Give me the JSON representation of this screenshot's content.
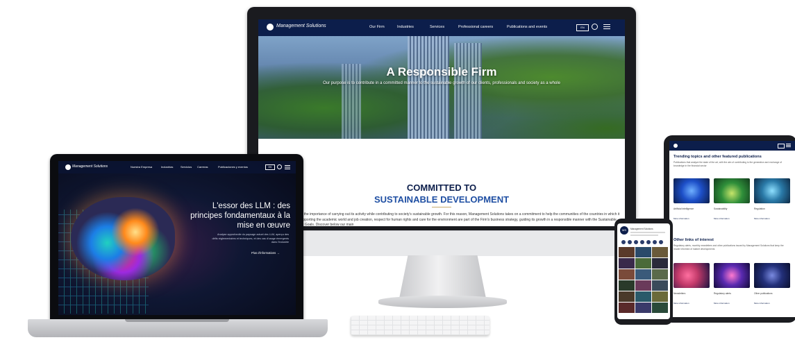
{
  "monitor": {
    "logo_text": "Management Solutions",
    "nav_items": [
      "Our Firm",
      "Industries",
      "Services",
      "Professional careers",
      "Publications and events"
    ],
    "lang": "EN",
    "hero_title": "A Responsible Firm",
    "hero_subtitle": "Our purpose is to contribute in a committed manner to the sustainable growth of our clients, professionals and society as a whole",
    "heading_line1": "COMMITTED TO",
    "heading_line2": "SUSTAINABLE DEVELOPMENT",
    "body_text": "...recognizes the importance of carrying out its activity while contributing to society's sustainable growth. For this reason, Management Solutions takes on a commitment to help the communities of the countries in which it operates. Supporting the academic world and job creation, respect for human rights and care for the environment are part of the Firm's business strategy, guiding its growth in a responsible manner with the Sustainable Development Goals. Discover below our main"
  },
  "laptop": {
    "logo_text": "Management Solutions",
    "nav_items": [
      "Nuestra Empresa",
      "Industrias",
      "Servicios",
      "Carreras",
      "Publicaciones y eventos"
    ],
    "lang": "ES",
    "title": "L'essor des LLM : des principes fondamentaux à la mise en œuvre",
    "subtitle": "Analyse approfondie du paysage actuel des LLM, aperçu des défis réglementaires et techniques, et des cas d'usage émergents dans l'industrie",
    "cta": "Plus d'informations"
  },
  "tablet": {
    "section1_title": "Trending topics and other featured publications",
    "section1_text": "Publications that analyze the state of the art, with the aim of contributing to the generation and exchange of knowledge in the financial sector",
    "cards1": [
      {
        "caption": "Artificial Intelligence",
        "more": "More information",
        "color": "#1d4fc8"
      },
      {
        "caption": "Sustainability",
        "more": "More information",
        "color": "#2f8f3a"
      },
      {
        "caption": "Regulation",
        "more": "More information",
        "color": "#2a7aa8"
      }
    ],
    "section2_title": "Other links of interest",
    "section2_text": "Regulatory alerts, monthly newsletters and other publications issued by Management Solutions that keep the reader informed of market developments",
    "cards2": [
      {
        "caption": "Newsletters",
        "more": "More information",
        "color": "#c23a6a"
      },
      {
        "caption": "Regulatory alerts",
        "more": "More information",
        "color": "#5a2ab0"
      },
      {
        "caption": "Other publications",
        "more": "More information",
        "color": "#23307a"
      }
    ]
  },
  "phone": {
    "logo_text": "MS",
    "header_text": "Management Solutions"
  }
}
